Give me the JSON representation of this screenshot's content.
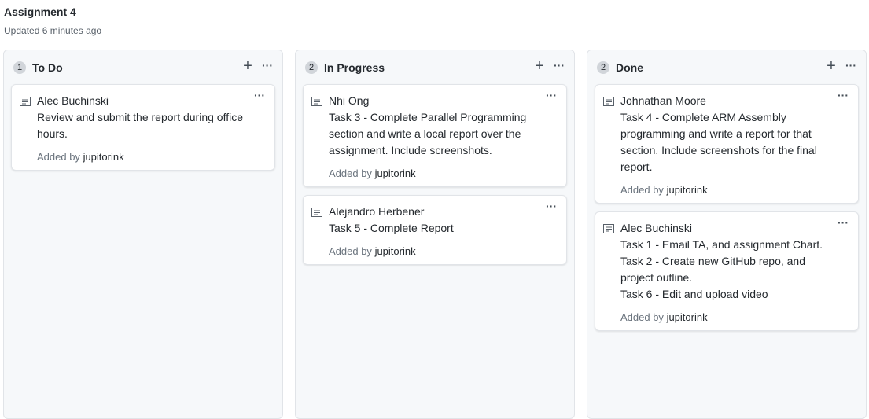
{
  "board": {
    "title": "Assignment 4",
    "updated": "Updated 6 minutes ago"
  },
  "columns": [
    {
      "name": "To Do",
      "count": "1",
      "add_icon": "plus-icon",
      "menu_icon": "kebab-horizontal-icon",
      "cards": [
        {
          "icon": "note-icon",
          "lines": [
            "Alec Buchinski",
            "Review and submit the report during office",
            "hours."
          ],
          "added_prefix": "Added by",
          "added_user": "jupitorink"
        }
      ]
    },
    {
      "name": "In Progress",
      "count": "2",
      "add_icon": "plus-icon",
      "menu_icon": "kebab-horizontal-icon",
      "cards": [
        {
          "icon": "note-icon",
          "lines": [
            "Nhi Ong",
            "Task 3 - Complete Parallel Programming",
            "section and write a local report over the",
            "assignment. Include screenshots."
          ],
          "added_prefix": "Added by",
          "added_user": "jupitorink"
        },
        {
          "icon": "note-icon",
          "lines": [
            "Alejandro Herbener",
            "Task 5 - Complete Report"
          ],
          "added_prefix": "Added by",
          "added_user": "jupitorink"
        }
      ]
    },
    {
      "name": "Done",
      "count": "2",
      "add_icon": "plus-icon",
      "menu_icon": "kebab-horizontal-icon",
      "cards": [
        {
          "icon": "note-icon",
          "lines": [
            "Johnathan Moore",
            "Task 4 - Complete ARM Assembly",
            "programming and write a report for that",
            "section. Include screenshots for the final",
            "report."
          ],
          "added_prefix": "Added by",
          "added_user": "jupitorink"
        },
        {
          "icon": "note-icon",
          "lines": [
            "Alec Buchinski",
            "Task 1 - Email TA, and assignment Chart.",
            "Task 2 - Create new GitHub repo, and",
            "project outline.",
            "Task 6 - Edit and upload video"
          ],
          "added_prefix": "Added by",
          "added_user": "jupitorink"
        }
      ]
    }
  ]
}
